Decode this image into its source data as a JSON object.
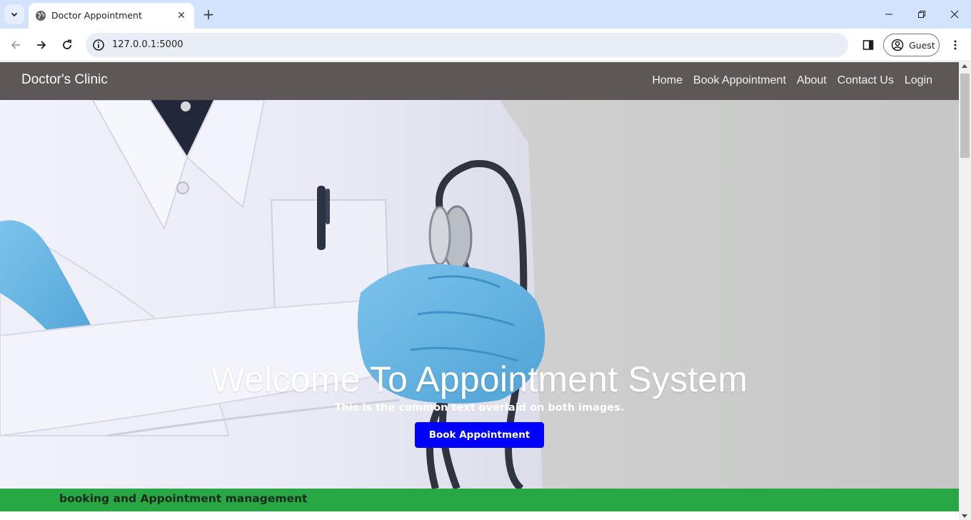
{
  "browser": {
    "tab_title": "Doctor Appointment",
    "url": "127.0.0.1:5000",
    "profile_label": "Guest",
    "icons": {
      "tab_search": "chevron-down-icon",
      "favicon": "globe-icon",
      "tab_close": "close-icon",
      "new_tab": "plus-icon",
      "minimize": "minimize-icon",
      "restore": "restore-icon",
      "close_window": "close-icon",
      "back": "arrow-left-icon",
      "forward": "arrow-right-icon",
      "reload": "reload-icon",
      "site_info": "info-icon",
      "side_panel": "side-panel-icon",
      "profile": "user-circle-icon",
      "menu": "kebab-menu-icon"
    }
  },
  "site": {
    "brand": "Doctor's Clinic",
    "nav": [
      {
        "label": "Home"
      },
      {
        "label": "Book Appointment"
      },
      {
        "label": "About"
      },
      {
        "label": "Contact Us"
      },
      {
        "label": "Login"
      }
    ],
    "hero": {
      "title": "Welcome To Appointment System",
      "subtitle": "This is the common text overlaid on both images.",
      "button_label": "Book Appointment"
    },
    "marquee_text": "booking and Appointment management"
  },
  "colors": {
    "navbar": "#5d5857",
    "hero_button": "#0000ff",
    "marquee": "#28a745",
    "tab_strip": "#d3e3fd"
  }
}
